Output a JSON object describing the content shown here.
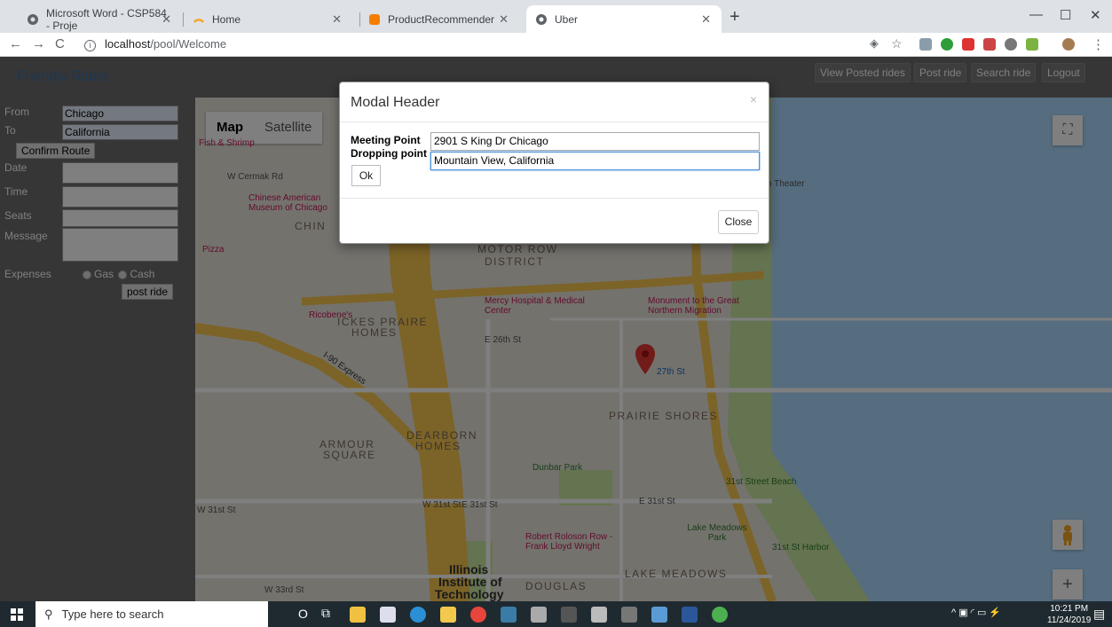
{
  "browser": {
    "tabs": [
      {
        "title": "Microsoft Word - CSP584 - Proje"
      },
      {
        "title": "Home"
      },
      {
        "title": "ProductRecommender"
      },
      {
        "title": "Uber"
      }
    ],
    "url_host": "localhost",
    "url_path": "/pool/Welcome"
  },
  "app": {
    "brand": "Friendly Rides",
    "nav": [
      "View Posted rides",
      "Post ride",
      "Search ride",
      "Logout"
    ]
  },
  "form": {
    "from_label": "From",
    "from_value": "Chicago",
    "to_label": "To",
    "to_value": "California",
    "confirm_button": "Confirm Route",
    "date_label": "Date",
    "time_label": "Time",
    "seats_label": "Seats",
    "message_label": "Message",
    "expenses_label": "Expenses",
    "gas_label": "Gas",
    "cash_label": "Cash",
    "post_button": "post ride"
  },
  "map": {
    "type_map": "Map",
    "type_satellite": "Satellite",
    "labels": {
      "fish": "Fish & Shrimp",
      "cermak_rd": "W Cermak Rd",
      "chinese_museum": "Chinese American Museum of Chicago",
      "chinatown": "CHIN",
      "pizza": "Pizza",
      "motor_row": "MOTOR ROW",
      "district": "DISTRICT",
      "mercy": "Mercy Hospital & Medical Center",
      "monument": "Monument to the Great Northern Migration",
      "ricobenes": "Ricobene's",
      "ickes": "ICKES PRAIRE",
      "homes": "HOMES",
      "e26": "E 26th St",
      "i90": "I-90 Express",
      "st27": "27th St",
      "prairie_shores": "PRAIRIE SHORES",
      "armour": "ARMOUR",
      "square": "SQUARE",
      "dearborn": "DEARBORN",
      "dearborn_homes": "HOMES",
      "dunbar": "Dunbar Park",
      "beach": "31st Street Beach",
      "w31": "W 31st St",
      "e31": "E 31st St",
      "w31b": "W 31st St",
      "e31b": "E 31st St",
      "robert": "Robert Roloson Row - Frank Lloyd Wright",
      "lake_meadows_park": "Lake Meadows Park",
      "harbor": "31st St Harbor",
      "lake_meadows": "LAKE MEADOWS",
      "iit1": "Illinois",
      "iit2": "Institute of",
      "iit3": "Technology",
      "douglas": "DOUGLAS",
      "w33": "W 33rd St",
      "theater": "n Theater"
    }
  },
  "modal": {
    "title": "Modal Header",
    "close_x": "×",
    "meeting_label": "Meeting Point",
    "meeting_value": "2901 S King Dr Chicago",
    "dropping_label": "Dropping point",
    "dropping_value": "Mountain View, California",
    "ok_button": "Ok",
    "close_button": "Close"
  },
  "taskbar": {
    "search_placeholder": "Type here to search",
    "time": "10:21 PM",
    "date": "11/24/2019"
  }
}
